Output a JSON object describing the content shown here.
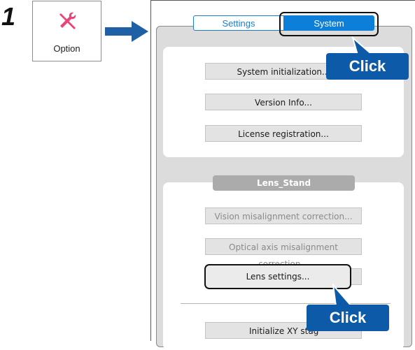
{
  "step": {
    "number": "1"
  },
  "option_button": {
    "label": "Option",
    "icon": "wrench-screwdriver-icon",
    "icon_color": "#e8467a"
  },
  "arrow": {
    "color": "#1f5fa6"
  },
  "tabs": [
    {
      "label": "Settings",
      "selected": false
    },
    {
      "label": "System",
      "selected": true
    }
  ],
  "system_group": {
    "buttons": [
      {
        "label": "System initialization..."
      },
      {
        "label": "Version Info..."
      },
      {
        "label": "License registration..."
      }
    ]
  },
  "lens_group": {
    "header": "Lens_Stand",
    "buttons": [
      {
        "label": "Vision misalignment correction...",
        "enabled": false
      },
      {
        "label": "Optical axis misalignment correction...",
        "enabled": false
      },
      {
        "label": "Lens settings...",
        "enabled": true
      },
      {
        "label": "Initialize XY stag",
        "enabled": true
      }
    ]
  },
  "callouts": [
    {
      "text": "Click"
    },
    {
      "text": "Click"
    }
  ],
  "colors": {
    "accent": "#0e7fd8",
    "callout": "#0d5aa8"
  }
}
